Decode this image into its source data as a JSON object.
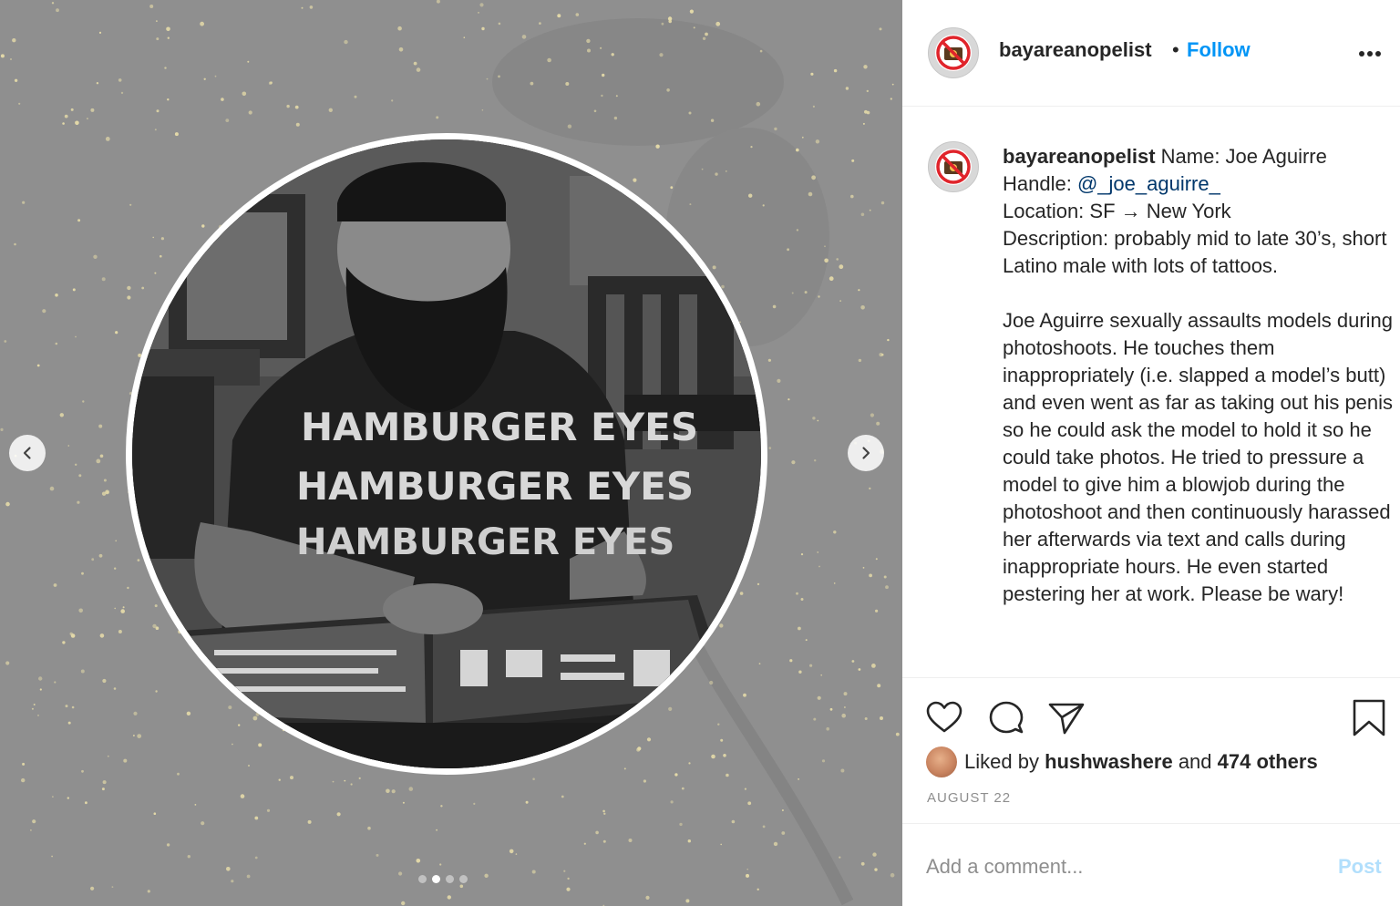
{
  "post": {
    "username": "bayareanopelist",
    "separator": "•",
    "follow_label": "Follow",
    "more_icon": "more-horizontal-icon",
    "avatar_icon": "no-camera-icon"
  },
  "media": {
    "shirt_text": "HAMBURGER EYES",
    "carousel_count": 4,
    "carousel_active_index": 1,
    "prev_icon": "chevron-left-icon",
    "next_icon": "chevron-right-icon"
  },
  "caption": {
    "username": "bayareanopelist",
    "line1": "Name: Joe Aguirre",
    "handle_label": "Handle:",
    "handle": "@_joe_aguirre_",
    "location": "Location: SF → New York",
    "description": "Description: probably mid to late 30’s, short Latino male with lots of tattoos.",
    "body": "Joe Aguirre sexually assaults models during photoshoots. He touches them inappropriately (i.e. slapped a model’s butt) and even went as far as taking out his penis so he could ask the model to hold it so he could take photos. He tried to pressure a model to give him a blowjob during the photoshoot and then continuously harassed her afterwards via text and calls during inappropriate hours. He even started pestering her at work. Please be wary!"
  },
  "actions": {
    "like_icon": "heart-icon",
    "comment_icon": "comment-icon",
    "share_icon": "send-icon",
    "save_icon": "bookmark-icon"
  },
  "likes": {
    "prefix": "Liked by",
    "liker": "hushwashere",
    "middle": "and",
    "others": "474 others"
  },
  "date": "AUGUST 22",
  "comment": {
    "placeholder": "Add a comment...",
    "post_label": "Post"
  },
  "colors": {
    "accent": "#0095f6",
    "post_disabled": "#b2dffc",
    "mention": "#00376b",
    "muted": "#8e8e8e",
    "media_bg": "#8f8f8f"
  }
}
